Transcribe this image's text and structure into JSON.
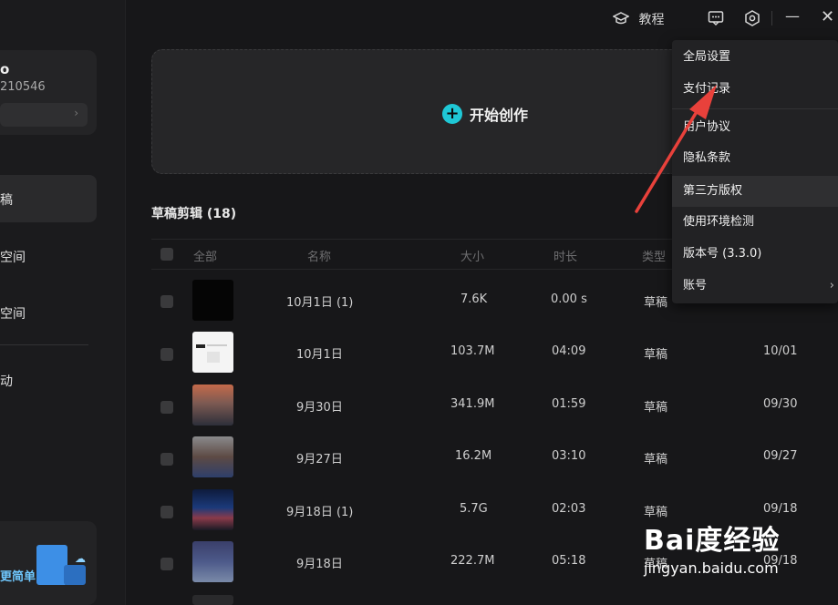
{
  "sidebar": {
    "user_name": "o",
    "user_id": "210546",
    "user_bar_arrow": "›",
    "items": [
      {
        "label": "稿"
      },
      {
        "label": "空间"
      },
      {
        "label": "空间"
      },
      {
        "label": "动"
      }
    ],
    "promo_text": "更简单"
  },
  "topbar": {
    "tutorial_label": "教程",
    "minimize": "—",
    "close": "✕"
  },
  "create": {
    "label": "开始创作"
  },
  "drafts": {
    "title": "草稿剪辑 (18)",
    "columns": {
      "all": "全部",
      "name": "名称",
      "size": "大小",
      "duration": "时长",
      "type": "类型"
    },
    "rows": [
      {
        "name": "10月1日 (1)",
        "size": "7.6K",
        "duration": "0.00 s",
        "type": "草稿",
        "date": ""
      },
      {
        "name": "10月1日",
        "size": "103.7M",
        "duration": "04:09",
        "type": "草稿",
        "date": "10/01"
      },
      {
        "name": "9月30日",
        "size": "341.9M",
        "duration": "01:59",
        "type": "草稿",
        "date": "09/30"
      },
      {
        "name": "9月27日",
        "size": "16.2M",
        "duration": "03:10",
        "type": "草稿",
        "date": "09/27"
      },
      {
        "name": "9月18日 (1)",
        "size": "5.7G",
        "duration": "02:03",
        "type": "草稿",
        "date": "09/18"
      },
      {
        "name": "9月18日",
        "size": "222.7M",
        "duration": "05:18",
        "type": "草稿",
        "date": "09/18"
      }
    ]
  },
  "menu": {
    "items": [
      {
        "label": "全局设置"
      },
      {
        "label": "支付记录"
      },
      {
        "label": "用户协议"
      },
      {
        "label": "隐私条款"
      },
      {
        "label": "第三方版权"
      },
      {
        "label": "使用环境检测"
      },
      {
        "label": "版本号 (3.3.0)"
      },
      {
        "label": "账号"
      }
    ],
    "submenu_arrow": "›"
  },
  "watermark": {
    "logo": "Bai度经验",
    "url": "jingyan.baidu.com"
  },
  "colors": {
    "accent": "#1fc8d6",
    "background": "#171719",
    "menu": "#222224",
    "arrow": "#e8413b"
  }
}
